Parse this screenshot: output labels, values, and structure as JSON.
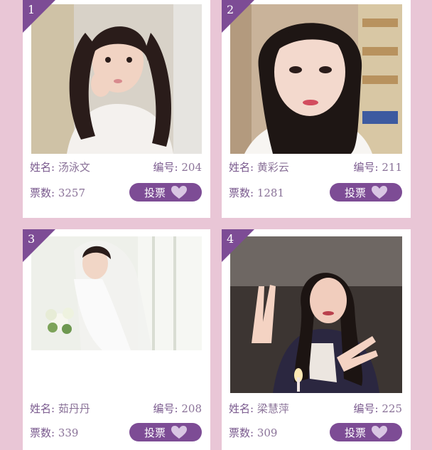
{
  "cards": [
    {
      "rank": "1",
      "name_label": "姓名:",
      "name": "汤泳文",
      "id_label": "编号:",
      "id": "204",
      "votes_label": "票数:",
      "votes": "3257",
      "vote_button": "投票"
    },
    {
      "rank": "2",
      "name_label": "姓名:",
      "name": "黄彩云",
      "id_label": "编号:",
      "id": "211",
      "votes_label": "票数:",
      "votes": "1281",
      "vote_button": "投票"
    },
    {
      "rank": "3",
      "name_label": "姓名:",
      "name": "茹丹丹",
      "id_label": "编号:",
      "id": "208",
      "votes_label": "票数:",
      "votes": "339",
      "vote_button": "投票"
    },
    {
      "rank": "4",
      "name_label": "姓名:",
      "name": "梁慧萍",
      "id_label": "编号:",
      "id": "225",
      "votes_label": "票数:",
      "votes": "309",
      "vote_button": "投票"
    }
  ],
  "colors": {
    "background": "#e9c6d6",
    "accent": "#7d4c95",
    "label_text": "#7a5a8e"
  }
}
